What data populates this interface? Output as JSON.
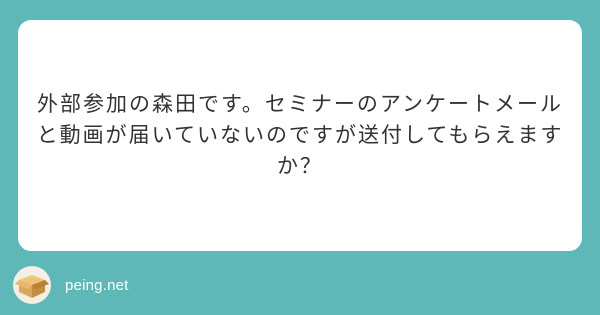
{
  "card": {
    "question": "外部参加の森田です。セミナーのアンケートメールと動画が届いていないのですが送付してもらえますか？"
  },
  "footer": {
    "brand_name": "peing.net",
    "logo_icon": "box-icon"
  },
  "colors": {
    "background": "#5fb8b8",
    "card": "#ffffff",
    "text": "#333333",
    "box": "#d9a85a"
  }
}
